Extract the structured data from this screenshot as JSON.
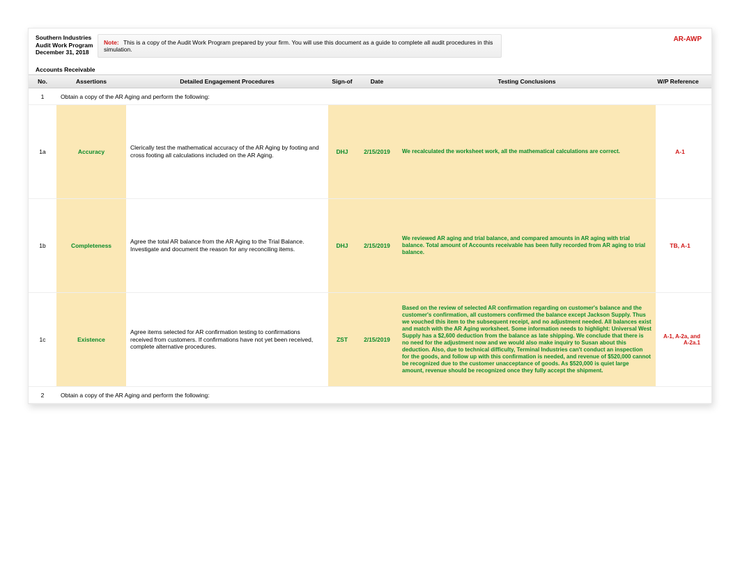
{
  "header": {
    "company": "Southern Industries",
    "title": "Audit Work Program",
    "date": "December 31, 2018",
    "doc_code": "AR-AWP",
    "note_label": "Note:",
    "note_text": "This is a copy of the Audit Work Program prepared by your firm.  You will use this document as a guide to complete all audit procedures in this simulation."
  },
  "section": "Accounts Receivable",
  "columns": {
    "no": "No.",
    "assertions": "Assertions",
    "procedures": "Detailed Engagement Procedures",
    "signof": "Sign-of",
    "date": "Date",
    "conclusions": "Testing Conclusions",
    "wp": "W/P Reference"
  },
  "rows": [
    {
      "type": "intro",
      "no": "1",
      "text": "Obtain a copy of the AR Aging and perform the following:"
    },
    {
      "type": "detail",
      "no": "1a",
      "assertion": "Accuracy",
      "procedure": "Clerically test the mathematical accuracy of the AR Aging by footing and cross footing all calculations included on the AR Aging.",
      "signof": "DHJ",
      "date": "2/15/2019",
      "conclusion": "We recalculated the worksheet work, all the mathematical calculations are correct.",
      "wp": "A-1"
    },
    {
      "type": "detail",
      "no": "1b",
      "assertion": "Completeness",
      "procedure": "Agree the total AR balance from the AR Aging to the Trial Balance.  Investigate and document the reason for any reconciling items.",
      "signof": "DHJ",
      "date": "2/15/2019",
      "conclusion": "We reviewed AR aging and trial balance, and compared amounts in AR aging with trial balance. Total amount of Accounts receivable has been fully recorded from AR aging to trial balance.",
      "wp": "TB, A-1"
    },
    {
      "type": "detail",
      "no": "1c",
      "assertion": "Existence",
      "procedure": "Agree items selected for AR confirmation testing to confirmations received from customers.  If confirmations have not yet been received, complete alternative procedures.",
      "signof": "ZST",
      "date": "2/15/2019",
      "conclusion": "Based on the review of selected AR confirmation regarding on customer's balance and the customer's confirmation, all customers confirmed the balance except Jackson Supply. Thus we vouched this item to the subsequent receipt, and no adjustment needed. All balances exist and match with the AR Aging worksheet. Some information needs to highlight: Universal West Supply has a $2,600 deduction from the balance as late shipping. We conclude that there is no need for the adjustment now and we would also make inquiry to Susan about this deduction. Also, due to technical difficulty, Terminal Industries can't conduct an inspection for the goods, and follow up with this confirmation is needed, and revenue of $520,000 cannot be recognized due to the customer unacceptance of goods. As $520,000 is quiet large amount, revenue should be recognized once they fully accept the shipment.",
      "wp": "A-1, A-2a, and A-2a.1"
    },
    {
      "type": "intro",
      "no": "2",
      "text": "Obtain a copy of the AR Aging and perform the following:"
    }
  ]
}
